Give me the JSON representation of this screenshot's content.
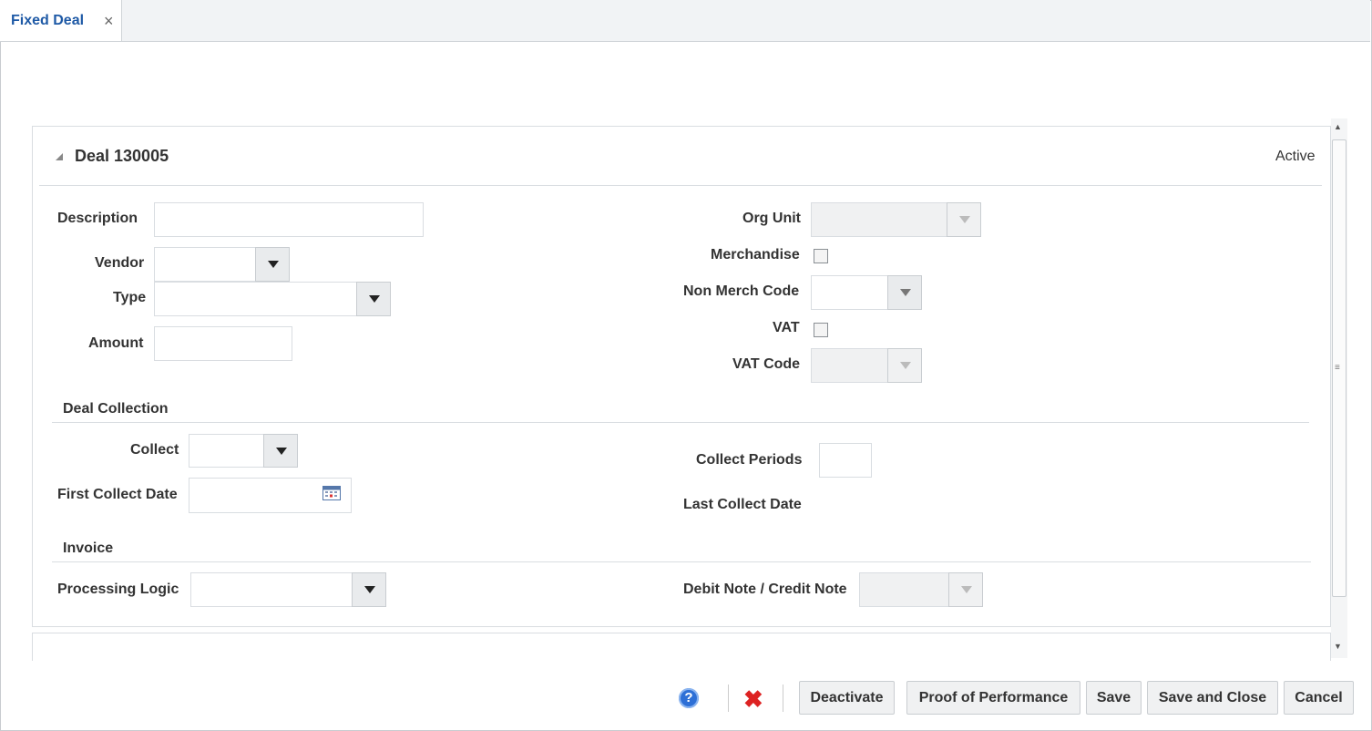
{
  "tab": {
    "label": "Fixed Deal",
    "close": "×"
  },
  "deal": {
    "title": "Deal 130005",
    "status": "Active"
  },
  "form": {
    "description": {
      "label": "Description",
      "value": ""
    },
    "vendor": {
      "label": "Vendor",
      "value": ""
    },
    "type": {
      "label": "Type",
      "value": ""
    },
    "amount": {
      "label": "Amount",
      "value": ""
    },
    "org_unit": {
      "label": "Org Unit",
      "value": ""
    },
    "merchandise": {
      "label": "Merchandise",
      "checked": false
    },
    "non_merch_code": {
      "label": "Non Merch Code",
      "value": ""
    },
    "vat": {
      "label": "VAT",
      "checked": false
    },
    "vat_code": {
      "label": "VAT Code",
      "value": ""
    }
  },
  "deal_collection": {
    "title": "Deal Collection",
    "collect": {
      "label": "Collect",
      "value": ""
    },
    "first_collect_date": {
      "label": "First Collect Date",
      "value": ""
    },
    "collect_periods": {
      "label": "Collect Periods",
      "value": ""
    },
    "last_collect_date": {
      "label": "Last Collect Date"
    }
  },
  "invoice": {
    "title": "Invoice",
    "processing_logic": {
      "label": "Processing Logic",
      "value": ""
    },
    "debit_credit_note": {
      "label": "Debit Note / Credit Note",
      "value": ""
    }
  },
  "buttons": {
    "help": "?",
    "deactivate": "Deactivate",
    "proof_of_performance": "Proof of Performance",
    "save": "Save",
    "save_and_close": "Save and Close",
    "cancel": "Cancel"
  },
  "colors": {
    "accent": "#1f5aa6",
    "delete": "#dd2222",
    "help": "#2d6fd6"
  }
}
